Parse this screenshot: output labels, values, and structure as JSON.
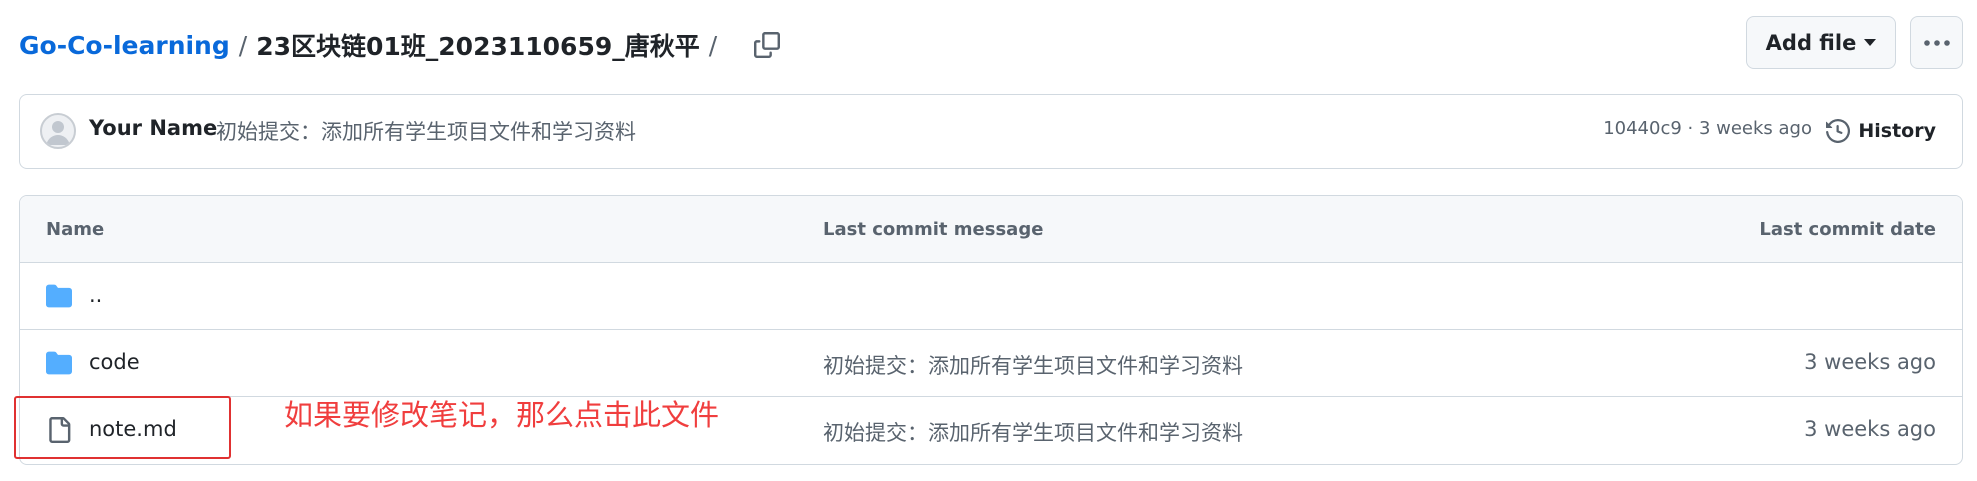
{
  "breadcrumb": {
    "repo": "Go-Co-learning",
    "separator": "/",
    "current_dir": "23区块链01班_2023110659_唐秋平",
    "trailing_separator": "/"
  },
  "buttons": {
    "add_file": "Add file"
  },
  "latest_commit": {
    "author": "Your Name",
    "message": "初始提交：添加所有学生项目文件和学习资料",
    "meta": "10440c9 · 3 weeks ago",
    "history_label": "History"
  },
  "table": {
    "headers": {
      "name": "Name",
      "message": "Last commit message",
      "date": "Last commit date"
    },
    "rows": [
      {
        "name": "..",
        "type": "directory",
        "message": "",
        "date": ""
      },
      {
        "name": "code",
        "type": "directory",
        "message": "初始提交：添加所有学生项目文件和学习资料",
        "date": "3 weeks ago"
      },
      {
        "name": "note.md",
        "type": "file",
        "message": "初始提交：添加所有学生项目文件和学习资料",
        "date": "3 weeks ago"
      }
    ]
  },
  "annotation": {
    "text": "如果要修改笔记，那么点击此文件",
    "color": "#f03e3e"
  },
  "colors": {
    "link": "#0969da",
    "folder": "#54aeff",
    "border": "#d1d9e0",
    "muted": "#59636e"
  }
}
